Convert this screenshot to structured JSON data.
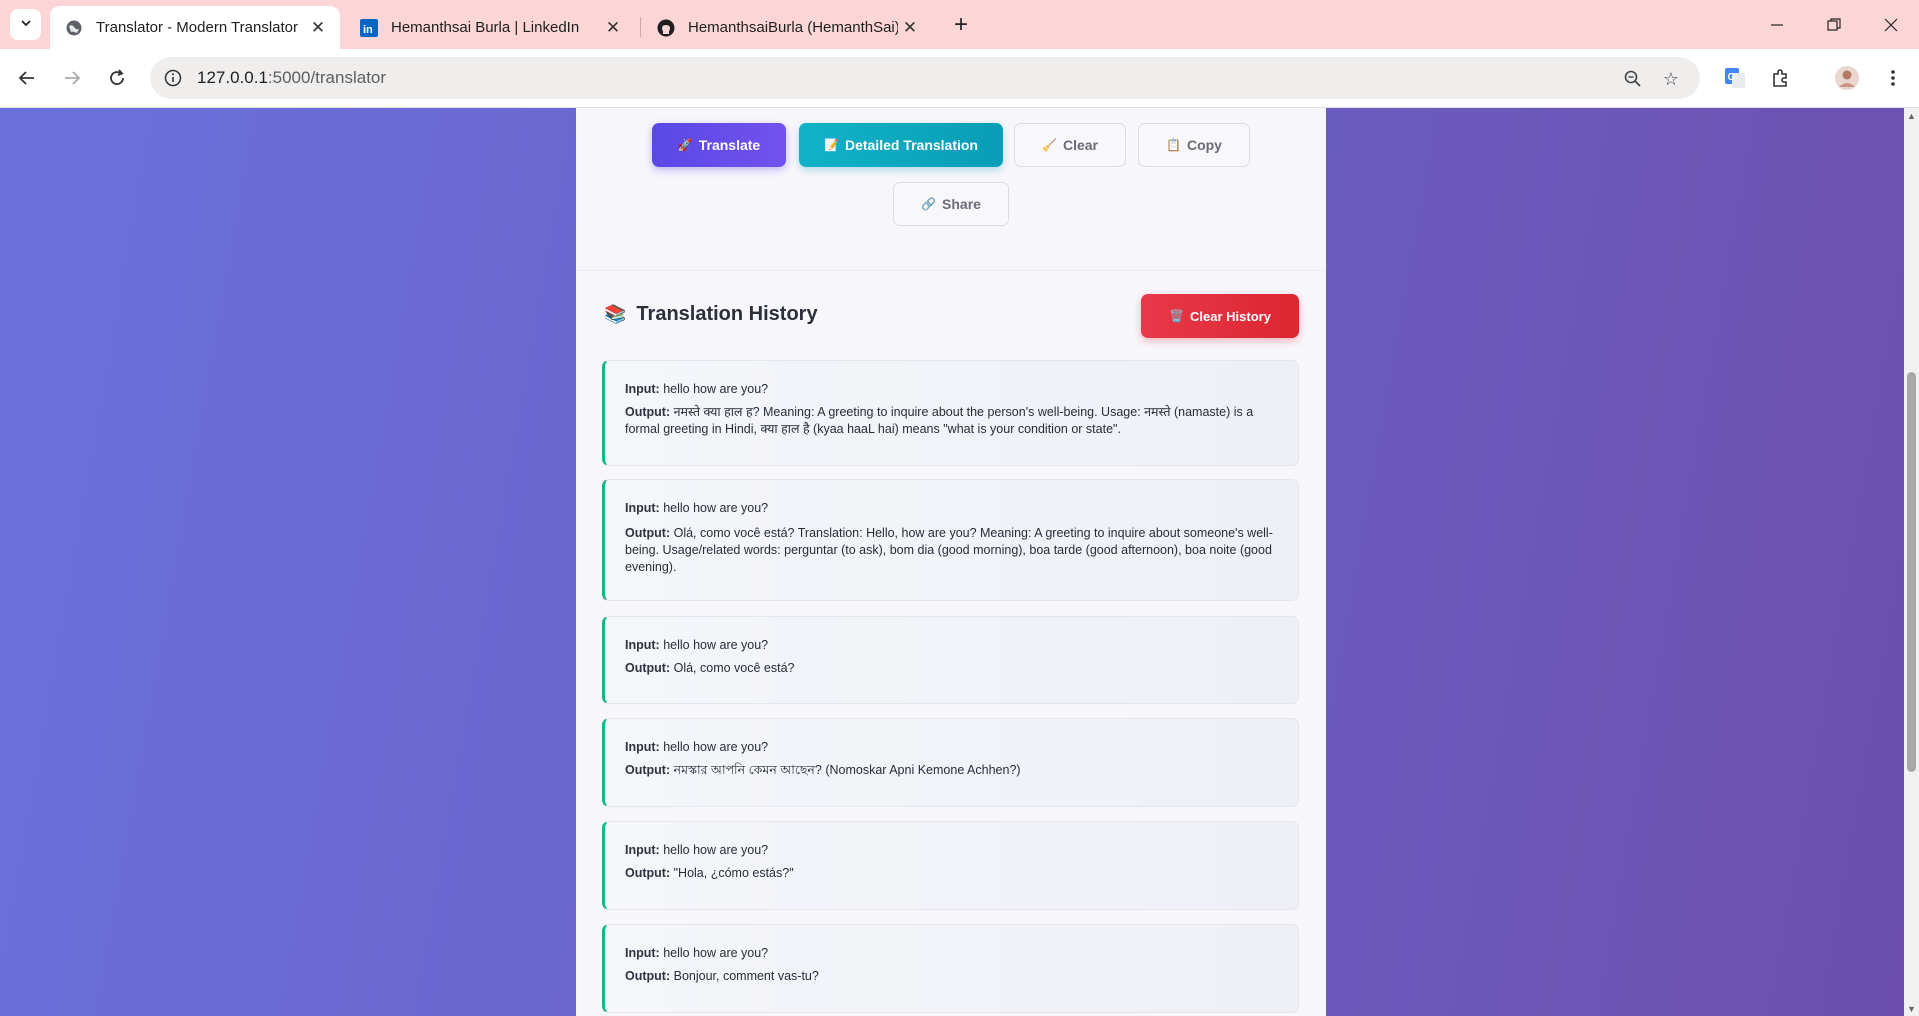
{
  "browser": {
    "tabs": [
      {
        "title": "Translator - Modern Translator",
        "active": true,
        "icon": "globe-icon"
      },
      {
        "title": "Hemanthsai Burla | LinkedIn",
        "active": false,
        "icon": "linkedin-icon"
      },
      {
        "title": "HemanthsaiBurla (HemanthSai)",
        "active": false,
        "icon": "github-icon"
      }
    ],
    "url_host": "127.0.0.1",
    "url_rest": ":5000/translator"
  },
  "actions": {
    "translate": "Translate",
    "detailed": "Detailed Translation",
    "clear": "Clear",
    "copy": "Copy",
    "share": "Share"
  },
  "history": {
    "title": "Translation History",
    "clear_label": "Clear History",
    "input_label": "Input:",
    "output_label": "Output:",
    "items": [
      {
        "input": "hello how are you?",
        "output": "नमस्ते क्या हाल ह?   Meaning: A greeting to inquire about the person's well-being. Usage: नमस्ते (namaste) is a formal greeting in Hindi, क्या हाल है (kyaa haaL hai) means \"what is your condition or state\"."
      },
      {
        "input": "hello how are you?",
        "output": "Olá, como você está? Translation: Hello, how are you? Meaning: A greeting to inquire about someone's well-being. Usage/related words: perguntar (to ask), bom dia (good morning), boa tarde (good afternoon), boa noite (good evening)."
      },
      {
        "input": "hello how are you?",
        "output": "Olá, como você está?"
      },
      {
        "input": "hello how are you?",
        "output": "নমস্কার আপনি কেমন আছেন? (Nomoskar Apni Kemone Achhen?)"
      },
      {
        "input": "hello how are you?",
        "output": "\"Hola, ¿cómo estás?\""
      },
      {
        "input": "hello how are you?",
        "output": "Bonjour, comment vas-tu?"
      }
    ]
  },
  "colors": {
    "accent": "#5a48e6",
    "teal": "#10b3c8",
    "danger": "#e9384a",
    "history_border": "#12b886"
  }
}
